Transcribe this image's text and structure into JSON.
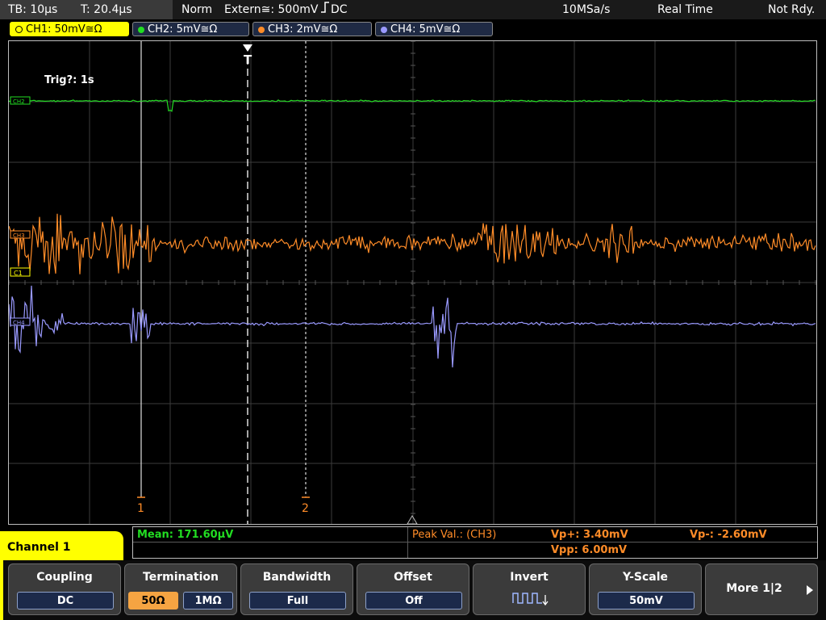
{
  "status": {
    "timebase": "TB: 10µs",
    "trigger_time": "T: 20.4µs",
    "mode": "Norm",
    "trigger_source": "Extern≅: 500mV",
    "trigger_coupling": "DC",
    "sample_rate": "10MSa/s",
    "acq_mode": "Real Time",
    "state": "Not Rdy."
  },
  "channels": [
    {
      "label": "CH1: 50mV≅Ω",
      "color": "#ffff00"
    },
    {
      "label": "CH2: 5mV≅Ω",
      "color": "#22dd22"
    },
    {
      "label": "CH3: 2mV≅Ω",
      "color": "#ff8c28"
    },
    {
      "label": "CH4: 5mV≅Ω",
      "color": "#9a9aff"
    }
  ],
  "screen": {
    "trig_info": "Trig?: 1s",
    "trigger_marker": "T",
    "cursor1_label": "1",
    "cursor2_label": "2",
    "ch2_tag": "CH2",
    "ch3_tag": "CH3",
    "ch1_tag": "C1",
    "ch4_tag": "CH4"
  },
  "measurements": {
    "mean": "Mean: 171.60µV",
    "peak_label": "Peak Val.:  (CH3)",
    "vp_plus": "Vp+: 3.40mV",
    "vp_minus": "Vp-: -2.60mV",
    "vpp": "Vpp: 6.00mV"
  },
  "menu": {
    "title": "Channel 1",
    "coupling_title": "Coupling",
    "coupling_value": "DC",
    "termination_title": "Termination",
    "term_50": "50Ω",
    "term_1m": "1MΩ",
    "bandwidth_title": "Bandwidth",
    "bandwidth_value": "Full",
    "offset_title": "Offset",
    "offset_value": "Off",
    "invert_title": "Invert",
    "yscale_title": "Y-Scale",
    "yscale_value": "50mV",
    "more_label": "More 1|2"
  },
  "colors": {
    "ch1": "#ffff00",
    "ch2": "#22dd22",
    "ch3": "#ff8c28",
    "ch4": "#9a9aff",
    "measure_green": "#22dd22",
    "measure_orange": "#ff8c28"
  }
}
